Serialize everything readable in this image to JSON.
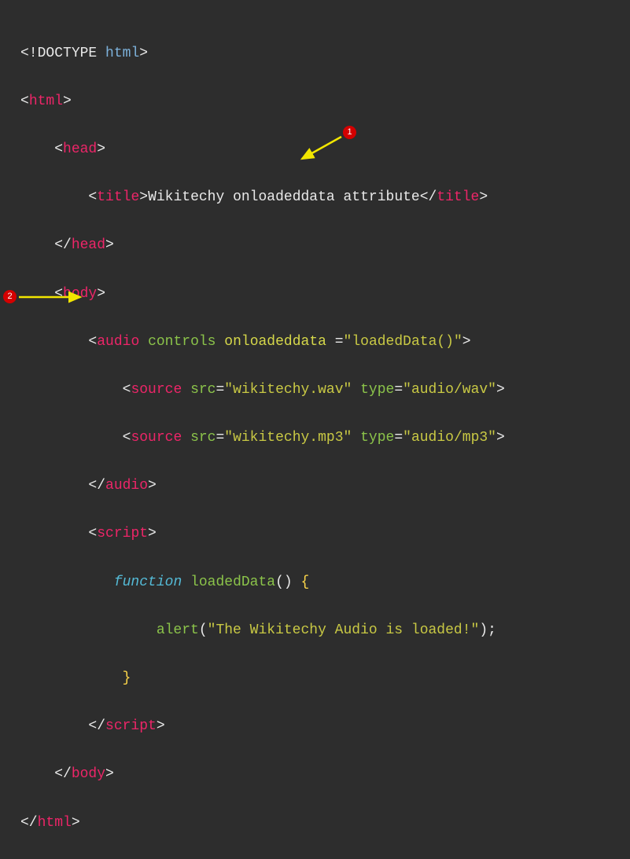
{
  "code": {
    "doctype_kw": "DOCTYPE",
    "doctype_name": "html",
    "tag_html": "html",
    "tag_head": "head",
    "tag_title": "title",
    "title_text": "Wikitechy onloadeddata attribute",
    "tag_body": "body",
    "tag_audio": "audio",
    "attr_controls": "controls",
    "attr_onloadeddata": "onloadeddata",
    "val_onloadeddata": "\"loadedData()\"",
    "tag_source": "source",
    "attr_src": "src",
    "val_src1": "\"wikitechy.wav\"",
    "attr_type": "type",
    "val_type1": "\"audio/wav\"",
    "val_src2": "\"wikitechy.mp3\"",
    "val_type2": "\"audio/mp3\"",
    "tag_script": "script",
    "kw_function": "function",
    "fn_name": "loadedData",
    "alert_fn": "alert",
    "alert_str": "\"The Wikitechy Audio is loaded!\"",
    "brace_open": "{",
    "brace_close": "}",
    "paren_open": "(",
    "paren_close": ")",
    "semicolon": ";"
  },
  "annotations": {
    "badge1": "1",
    "badge2": "2"
  }
}
